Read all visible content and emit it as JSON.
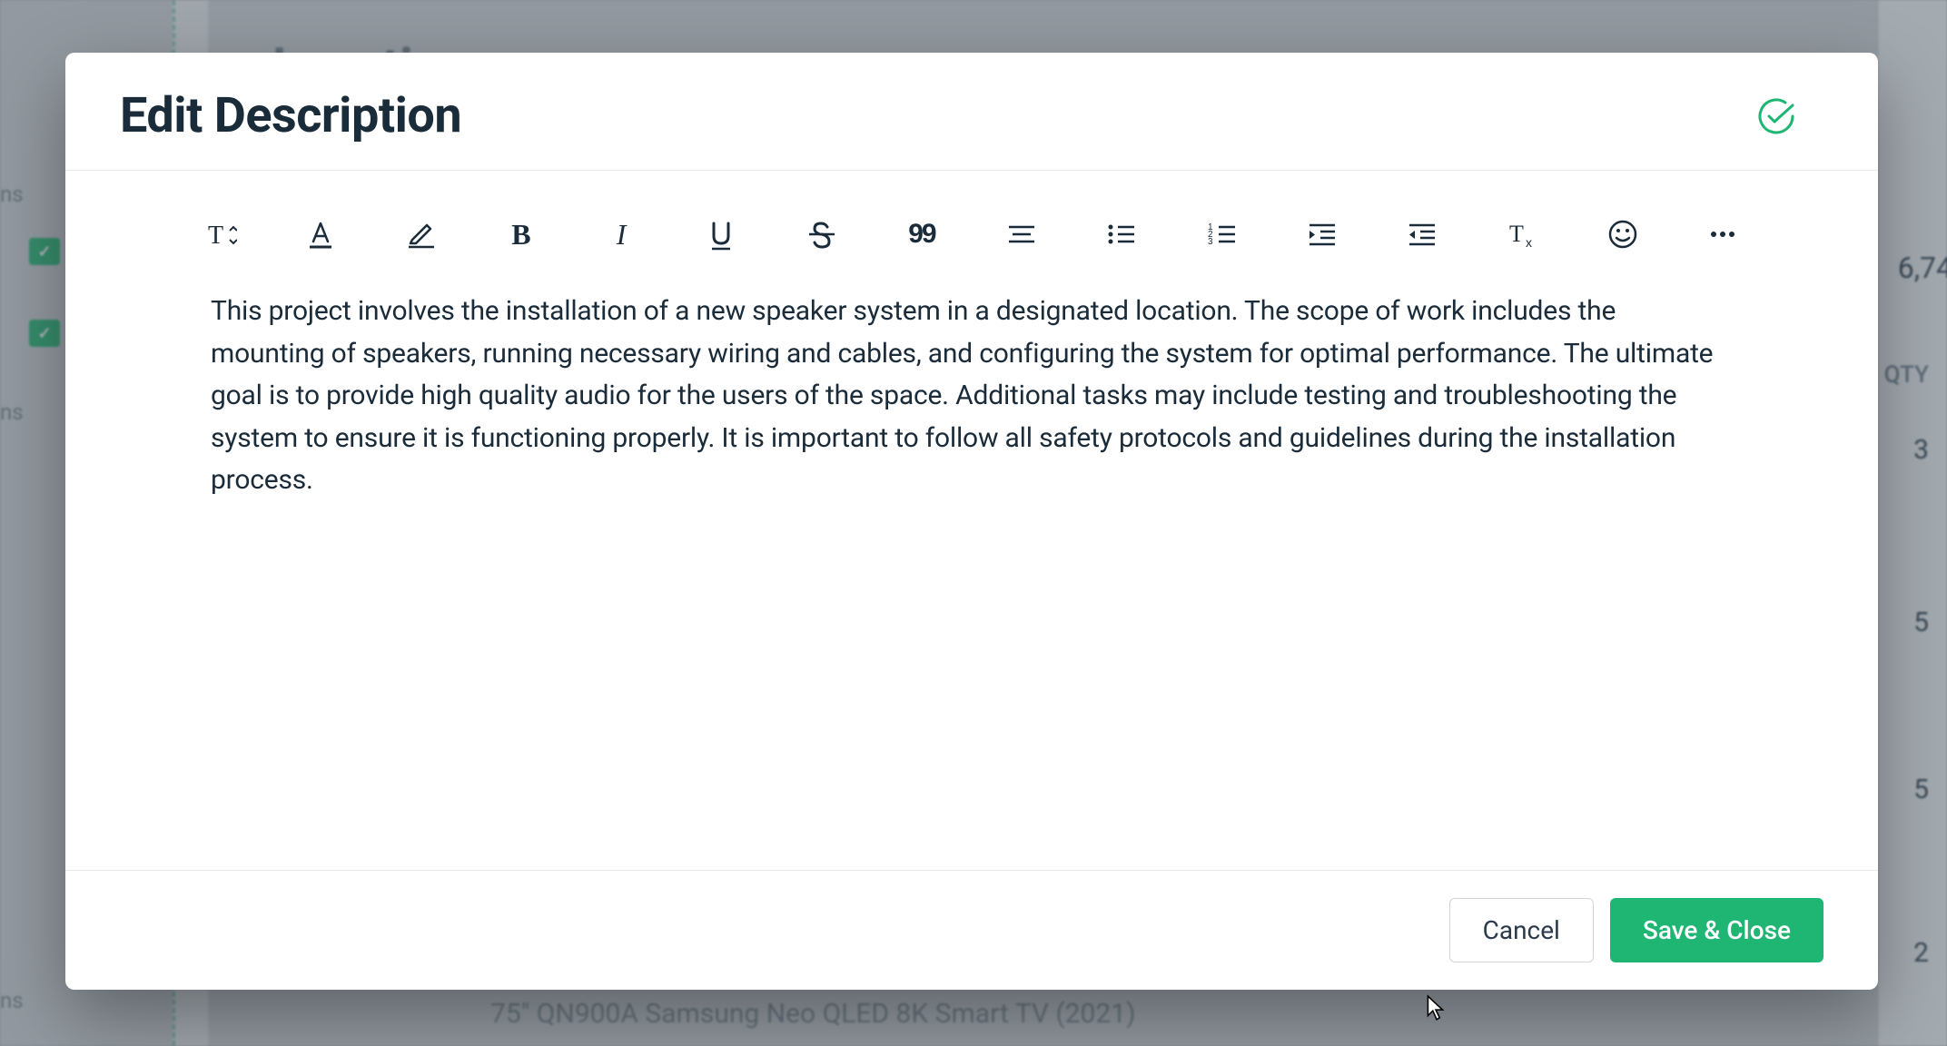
{
  "background": {
    "heading": "Locations",
    "sidebar_labels": [
      "ns",
      "ns",
      "ns"
    ],
    "right_header": "QTY",
    "right_values": [
      "6,74",
      "3",
      "5",
      "5",
      "2"
    ],
    "product_text": "75\" QN900A Samsung Neo QLED 8K Smart TV (2021)"
  },
  "modal": {
    "title": "Edit Description",
    "content": "This project involves the installation of a new speaker system in a designated location. The scope of work includes the mounting of speakers, running necessary wiring and cables, and configuring the system for optimal performance. The ultimate goal is to provide high quality audio for the users of the space. Additional tasks may include testing and troubleshooting the system to ensure it is functioning properly. It is important to follow all safety protocols and guidelines during the installation process.",
    "toolbar": {
      "quote_label": "99"
    },
    "footer": {
      "cancel": "Cancel",
      "save": "Save & Close"
    }
  }
}
